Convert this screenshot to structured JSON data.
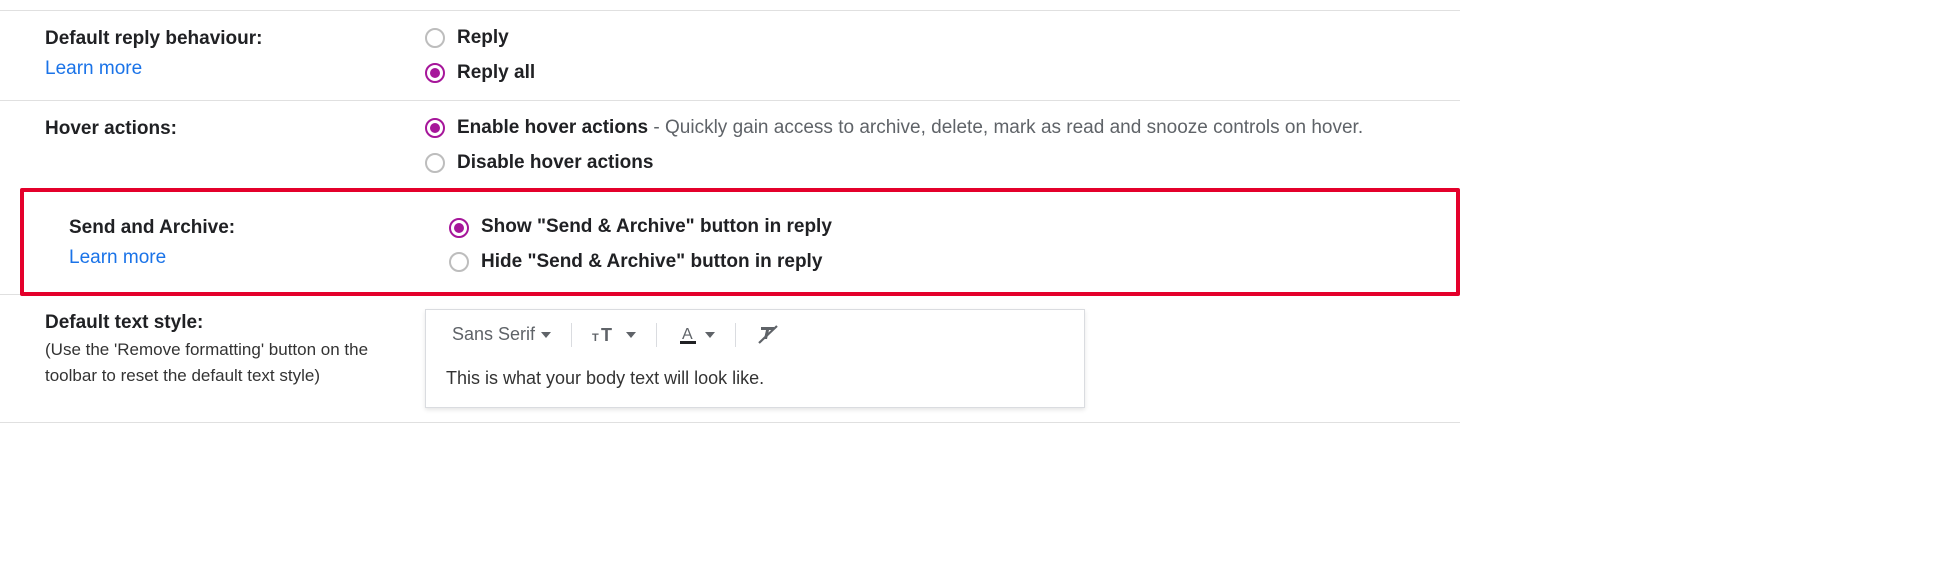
{
  "reply": {
    "title": "Default reply behaviour:",
    "learn": "Learn more",
    "opt1": "Reply",
    "opt2": "Reply all"
  },
  "hover": {
    "title": "Hover actions:",
    "opt1": "Enable hover actions",
    "desc1": " - Quickly gain access to archive, delete, mark as read and snooze controls on hover.",
    "opt2": "Disable hover actions"
  },
  "sendarchive": {
    "title": "Send and Archive:",
    "learn": "Learn more",
    "opt1": "Show \"Send & Archive\" button in reply",
    "opt2": "Hide \"Send & Archive\" button in reply"
  },
  "textstyle": {
    "title": "Default text style:",
    "hint": "(Use the 'Remove formatting' button on the toolbar to reset the default text style)",
    "font": "Sans Serif",
    "sample": "This is what your body text will look like."
  }
}
